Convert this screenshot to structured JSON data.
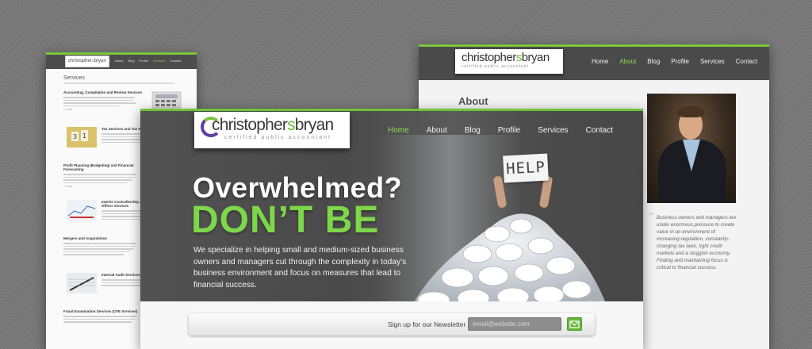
{
  "services_page": {
    "nav": [
      "Home",
      "About",
      "Blog",
      "Profile",
      "Services",
      "Contact"
    ],
    "nav_active": "Services",
    "title": "Services",
    "items": [
      {
        "title": "Accounting, Compilation and Review Services"
      },
      {
        "title": "Tax Services and Tax Planning"
      },
      {
        "title": "Profit Planning (Budgeting) and Financial Forecasting"
      },
      {
        "title": "Interim Controllership and Chief Financial Officer Services"
      },
      {
        "title": "Mergers and Acquisitions"
      },
      {
        "title": "Internal Audit Services"
      },
      {
        "title": "Fraud Examination Services (CFE Services)"
      }
    ]
  },
  "about_page": {
    "logo": {
      "first": "christopher",
      "s": "s",
      "last": "bryan"
    },
    "nav": [
      "Home",
      "About",
      "Blog",
      "Profile",
      "Services",
      "Contact"
    ],
    "nav_active": "About",
    "title": "About",
    "quote": "Business owners and managers are under enormous pressure to create value in an environment of increasing regulation, constantly-changing tax laws, tight credit markets and a sluggish economy. Finding and maintaining focus is critical to financial success."
  },
  "home_page": {
    "logo": {
      "first": "christopher",
      "s": "s",
      "last": "bryan",
      "tagline": "certified public accountant"
    },
    "nav": [
      "Home",
      "About",
      "Blog",
      "Profile",
      "Services",
      "Contact"
    ],
    "nav_active": "Home",
    "headline": "Overwhelmed?",
    "subheadline": "DON’T BE",
    "body": "We specialize in helping small and medium-sized business owners and managers cut through the complexity in today’s business environment and focus on measures that lead to financial success.",
    "sign_text": "HELP",
    "newsletter": {
      "label": "Sign up for our Newsletter",
      "placeholder": "email@website.com"
    }
  },
  "colors": {
    "accent_green": "#7ed64a",
    "header_dark": "#4a4a4a",
    "logo_purple": "#5b3fa0"
  }
}
